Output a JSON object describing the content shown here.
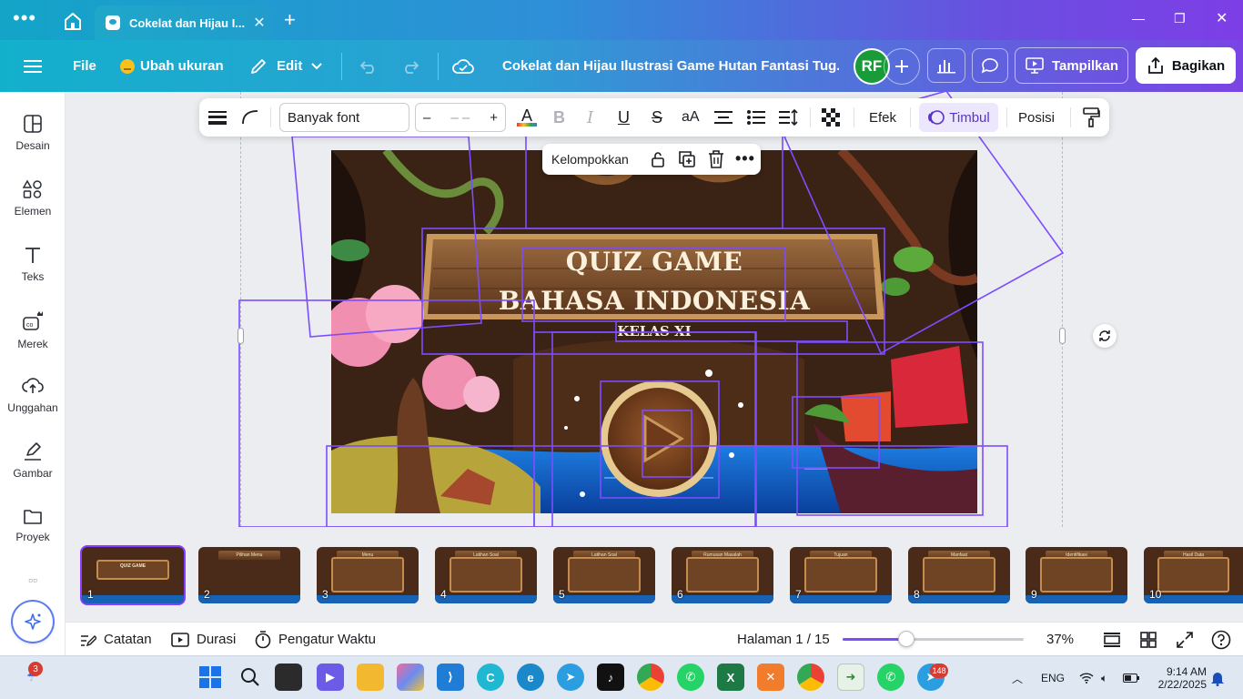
{
  "browser": {
    "tab_title": "Cokelat dan Hijau I...",
    "new_tab": "+"
  },
  "toolbar": {
    "menu_label": "File",
    "resize_label": "Ubah ukuran",
    "edit_label": "Edit",
    "doc_title": "Cokelat dan Hijau Ilustrasi Game Hutan Fantasi Tug...",
    "avatar_initials": "RF",
    "present_label": "Tampilkan",
    "share_label": "Bagikan"
  },
  "sidebar": {
    "items": [
      {
        "label": "Desain",
        "icon": "design-icon"
      },
      {
        "label": "Elemen",
        "icon": "elements-icon"
      },
      {
        "label": "Teks",
        "icon": "text-icon"
      },
      {
        "label": "Merek",
        "icon": "brand-icon"
      },
      {
        "label": "Unggahan",
        "icon": "upload-icon"
      },
      {
        "label": "Gambar",
        "icon": "draw-icon"
      },
      {
        "label": "Proyek",
        "icon": "folder-icon"
      }
    ]
  },
  "context_toolbar": {
    "font_name": "Banyak font",
    "font_size": "– –",
    "minus": "–",
    "plus": "+",
    "text_color_label": "A",
    "bold_label": "B",
    "italic_label": "I",
    "underline_label": "U",
    "strike_label": "S",
    "case_label": "aA",
    "effects_label": "Efek",
    "animate_label": "Timbul",
    "position_label": "Posisi"
  },
  "group_bar": {
    "group_label": "Kelompokkan"
  },
  "slide": {
    "title_line1": "QUIZ GAME",
    "title_line2": "BAHASA INDONESIA",
    "subtitle": "KELAS XI"
  },
  "thumbnails": [
    {
      "num": "1",
      "title": "QUIZ GAME"
    },
    {
      "num": "2",
      "title": "Pilihan Menu"
    },
    {
      "num": "3",
      "title": "Menu"
    },
    {
      "num": "4",
      "title": "Latihan Soal"
    },
    {
      "num": "5",
      "title": "Latihan Soal"
    },
    {
      "num": "6",
      "title": "Rumusan Masalah"
    },
    {
      "num": "7",
      "title": "Tujuan"
    },
    {
      "num": "8",
      "title": "Manfaat"
    },
    {
      "num": "9",
      "title": "Identifikasi"
    },
    {
      "num": "10",
      "title": "Hasil Data"
    }
  ],
  "statusbar": {
    "notes_label": "Catatan",
    "duration_label": "Durasi",
    "timer_label": "Pengatur Waktu",
    "page_label": "Halaman 1 / 15",
    "zoom_level": "37%",
    "zoom_fraction": 0.37
  },
  "taskbar": {
    "weather_badge": "3",
    "telegram_badge": "148",
    "lang": "ENG",
    "time": "9:14 AM",
    "date": "2/22/2025"
  },
  "colors": {
    "accent": "#8b3dff",
    "selection": "#7c4dff",
    "toolbar_start": "#13b0cc",
    "toolbar_end": "#7a44e4"
  }
}
